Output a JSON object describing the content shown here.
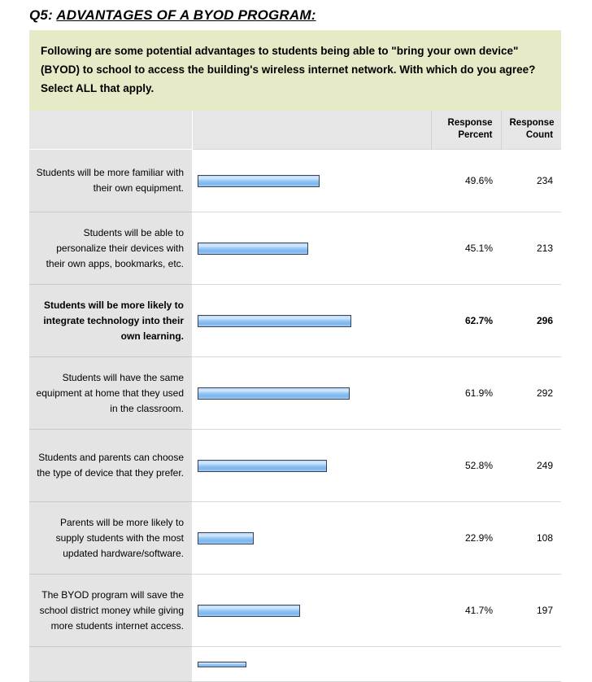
{
  "title": {
    "question_number": "Q5:",
    "question_title": "ADVANTAGES OF A BYOD PROGRAM:"
  },
  "prompt": "Following are some potential advantages to students being able to \"bring your own device\" (BYOD) to school to access the building's wireless internet network. With which do you agree? Select ALL that apply.",
  "table": {
    "headers": {
      "answer": "",
      "bar": "",
      "response_percent": "Response Percent",
      "response_count": "Response Count"
    },
    "bar_color": "#8fc3f4",
    "bar_border_color": "#35425c",
    "prompt_background": "#e7eac7",
    "label_background": "#e4e4e4",
    "header_background": "#e6e6e6"
  },
  "chart_data": {
    "type": "bar",
    "title": "Q5: ADVANTAGES OF A BYOD PROGRAM:",
    "subtitle": "Following are some potential advantages to students being able to \"bring your own device\" (BYOD) to school to access the building's wireless internet network. With which do you agree? Select ALL that apply.",
    "xlabel": "Response Percent",
    "ylabel": "",
    "xlim": [
      0,
      100
    ],
    "grid": false,
    "legend": null,
    "orientation": "horizontal",
    "value_unit": "percent",
    "categories": [
      "Students will be more familiar with their own equipment.",
      "Students will be able to personalize their devices with their own apps, bookmarks, etc.",
      "Students will be more likely to integrate technology into their own learning.",
      "Students will have the same equipment at home that they used in the classroom.",
      "Students and parents can choose the type of device that they prefer.",
      "Parents will be more likely to supply students with the most updated hardware/software.",
      "The BYOD program will save the school district money while giving more students internet access.",
      ""
    ],
    "values": [
      49.6,
      45.1,
      62.7,
      61.9,
      52.8,
      22.9,
      41.7,
      null
    ],
    "counts": [
      234,
      213,
      296,
      292,
      249,
      108,
      197,
      null
    ],
    "highlighted_index": 2
  },
  "rows": [
    {
      "label": "Students will be more familiar with their own equipment.",
      "percent": "49.6%",
      "percent_value": 49.6,
      "count": "234",
      "bold": false,
      "partial": false
    },
    {
      "label": "Students will be able to personalize their devices with their own apps, bookmarks, etc.",
      "percent": "45.1%",
      "percent_value": 45.1,
      "count": "213",
      "bold": false,
      "partial": false
    },
    {
      "label": "Students will be more likely to integrate technology into their own learning.",
      "percent": "62.7%",
      "percent_value": 62.7,
      "count": "296",
      "bold": true,
      "partial": false
    },
    {
      "label": "Students will have the same equipment at home that they used in the classroom.",
      "percent": "61.9%",
      "percent_value": 61.9,
      "count": "292",
      "bold": false,
      "partial": false
    },
    {
      "label": "Students and parents can choose the type of device that they prefer.",
      "percent": "52.8%",
      "percent_value": 52.8,
      "count": "249",
      "bold": false,
      "partial": false
    },
    {
      "label": "Parents will be more likely to supply students with the most updated hardware/software.",
      "percent": "22.9%",
      "percent_value": 22.9,
      "count": "108",
      "bold": false,
      "partial": false
    },
    {
      "label": "The BYOD program will save the school district money while giving more students internet access.",
      "percent": "41.7%",
      "percent_value": 41.7,
      "count": "197",
      "bold": false,
      "partial": false
    },
    {
      "label": "",
      "percent": "",
      "percent_value": 20,
      "count": "",
      "bold": false,
      "partial": true
    }
  ]
}
